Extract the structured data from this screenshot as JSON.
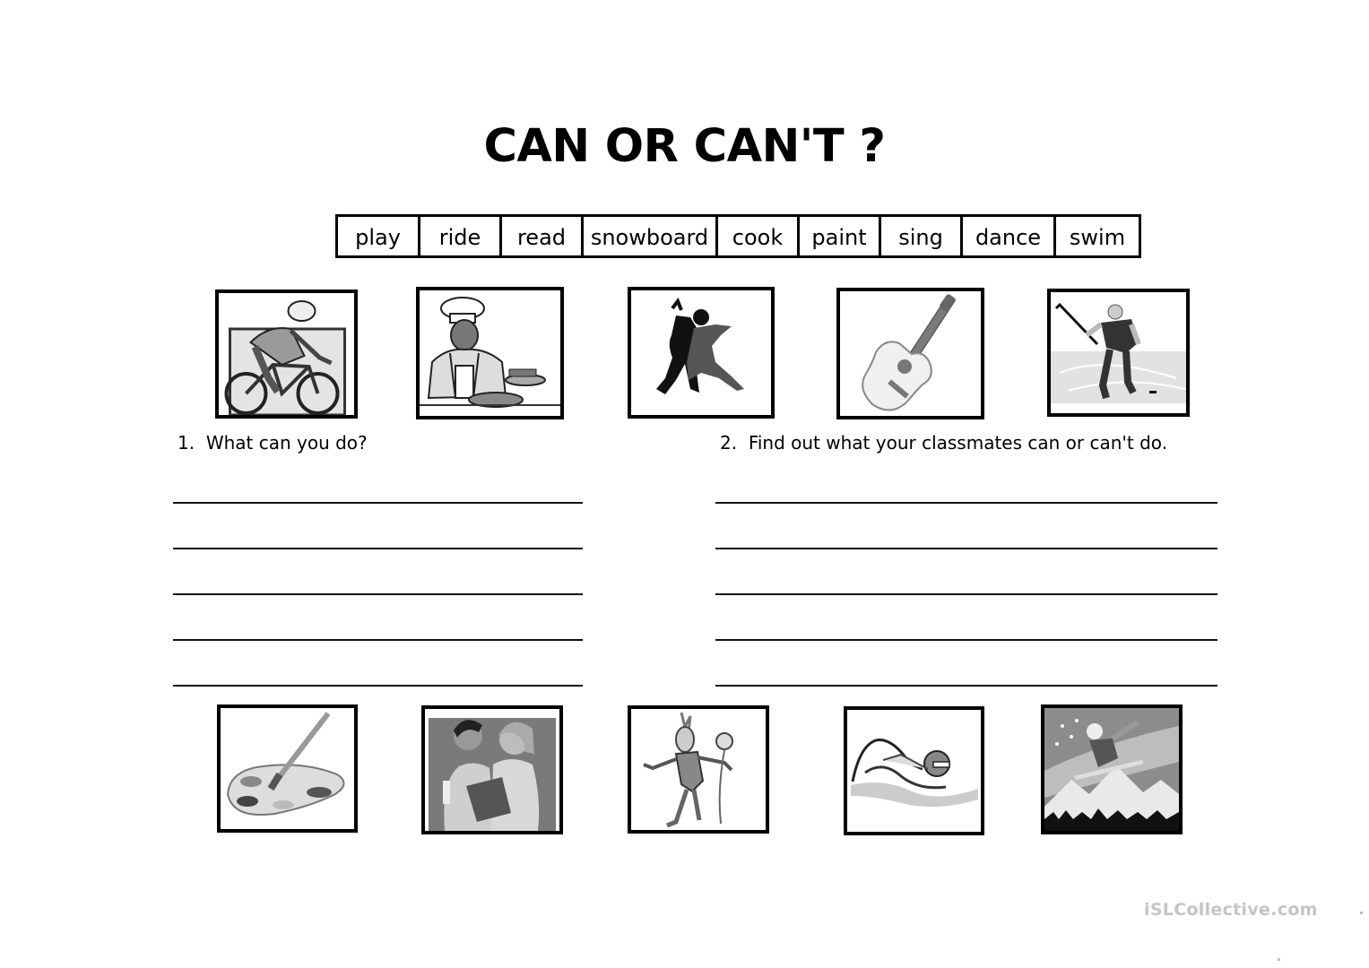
{
  "worksheet": {
    "title": "CAN OR CAN'T ?",
    "word_bank": [
      "play",
      "ride",
      "read",
      "snowboard",
      "cook",
      "paint",
      "sing",
      "dance",
      "swim"
    ],
    "top_pictures": [
      {
        "icon": "cyclist-icon",
        "depicts": "person riding a bicycle"
      },
      {
        "icon": "chef-icon",
        "depicts": "chef cooking"
      },
      {
        "icon": "dancers-icon",
        "depicts": "couple dancing"
      },
      {
        "icon": "guitar-icon",
        "depicts": "acoustic guitar"
      },
      {
        "icon": "hockey-player-icon",
        "depicts": "ice hockey player"
      }
    ],
    "bottom_pictures": [
      {
        "icon": "paint-palette-icon",
        "depicts": "paint palette and brush"
      },
      {
        "icon": "readers-icon",
        "depicts": "two women reading a book"
      },
      {
        "icon": "singer-icon",
        "depicts": "singer with microphone"
      },
      {
        "icon": "swimmer-icon",
        "depicts": "swimmer"
      },
      {
        "icon": "snowboarder-icon",
        "depicts": "snowboarder jumping"
      }
    ],
    "questions": [
      {
        "number": "1.",
        "text": "What can you do?",
        "answer_lines": 5
      },
      {
        "number": "2.",
        "text": "Find out what your classmates can or can't do.",
        "answer_lines": 5
      }
    ],
    "watermark": "iSLCollective.com"
  }
}
